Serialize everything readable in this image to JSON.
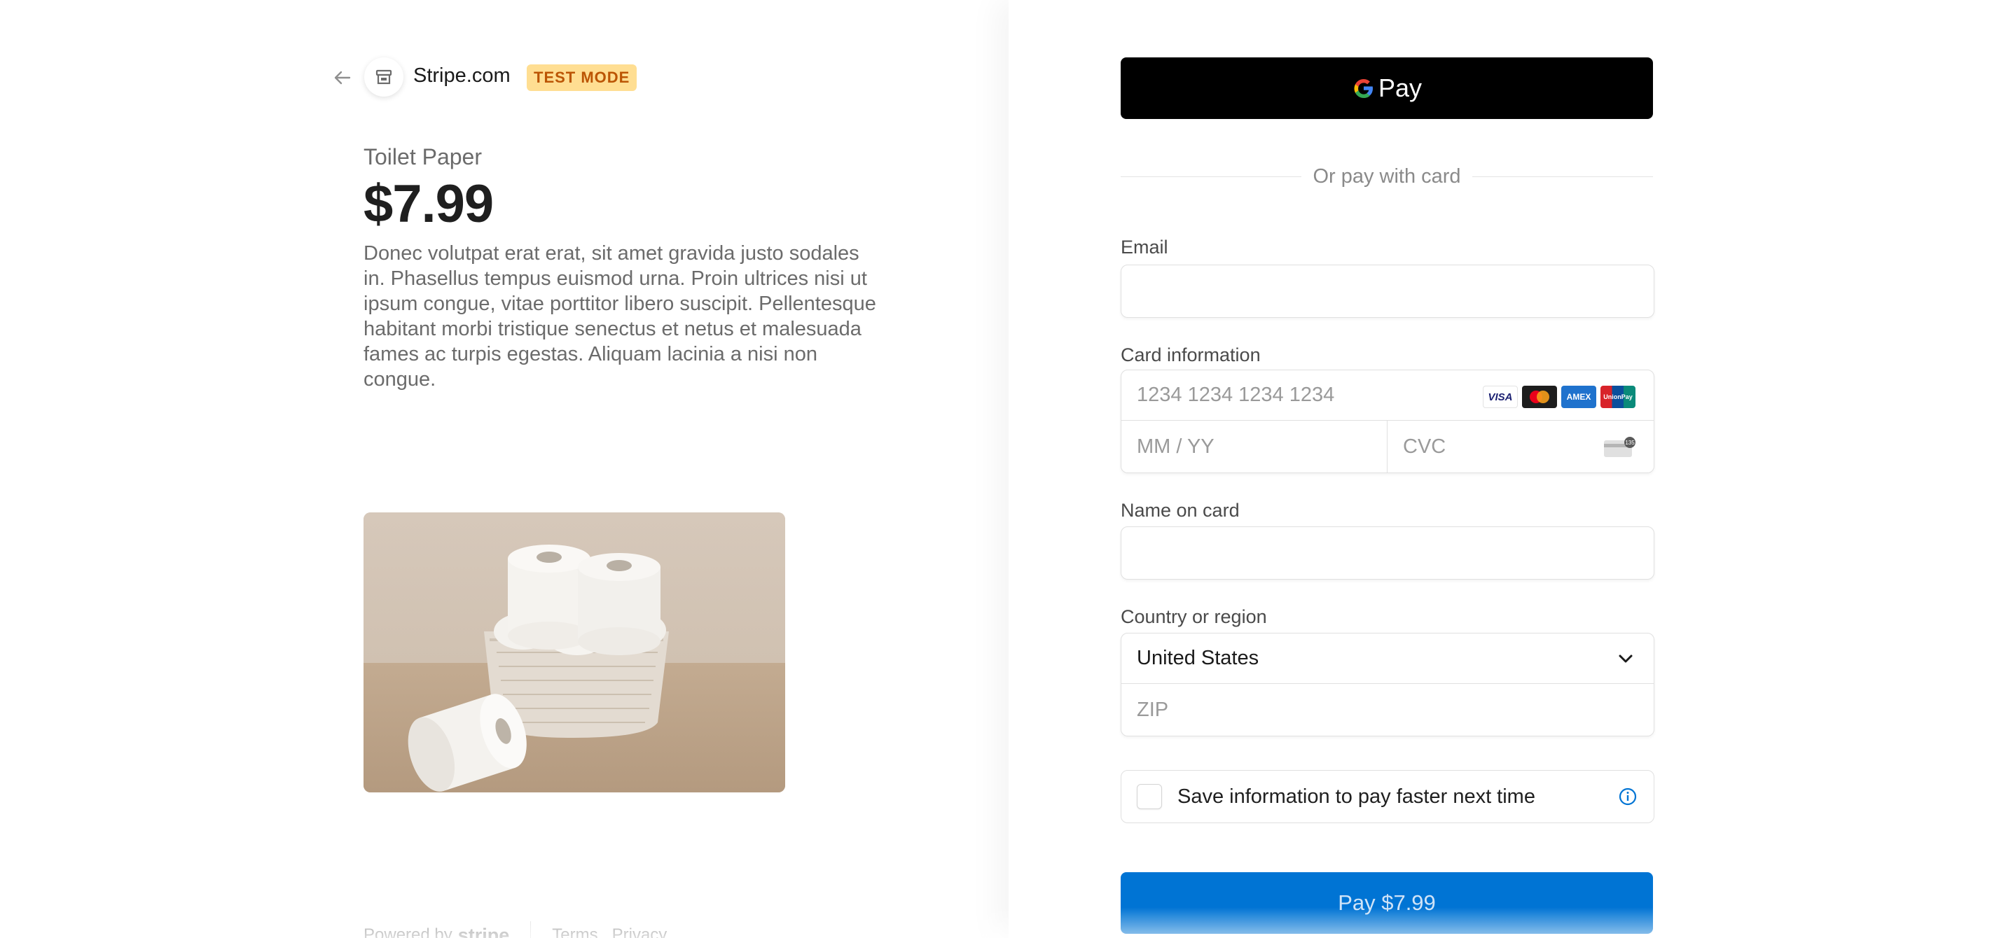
{
  "header": {
    "store_name": "Stripe.com",
    "badge": "TEST MODE",
    "back_icon": "arrow-left-icon",
    "store_icon": "store-icon"
  },
  "product": {
    "name": "Toilet Paper",
    "price": "$7.99",
    "description": "Donec volutpat erat erat, sit amet gravida justo sodales in. Phasellus tempus euismod urna. Proin ultrices nisi ut ipsum congue, vitae porttitor libero suscipit. Pellentesque habitant morbi tristique senectus et netus et malesuada fames ac turpis egestas. Aliquam lacinia a nisi non congue."
  },
  "footer": {
    "powered_by": "Powered by",
    "brand": "stripe",
    "terms": "Terms",
    "privacy": "Privacy"
  },
  "payment": {
    "gpay_label": "Pay",
    "divider": "Or pay with card",
    "email_label": "Email",
    "email_value": "",
    "card_label": "Card information",
    "card_number_placeholder": "1234 1234 1234 1234",
    "expiry_placeholder": "MM / YY",
    "cvc_placeholder": "CVC",
    "card_brands": [
      "VISA",
      "Mastercard",
      "AMEX",
      "UnionPay"
    ],
    "name_label": "Name on card",
    "name_value": "",
    "country_label": "Country or region",
    "country_value": "United States",
    "zip_placeholder": "ZIP",
    "save_label": "Save information to pay faster next time",
    "pay_button": "Pay $7.99"
  },
  "colors": {
    "accent": "#0074d4",
    "badge_bg": "#ffde92",
    "badge_text": "#bb5504",
    "gpay_bg": "#000000"
  }
}
